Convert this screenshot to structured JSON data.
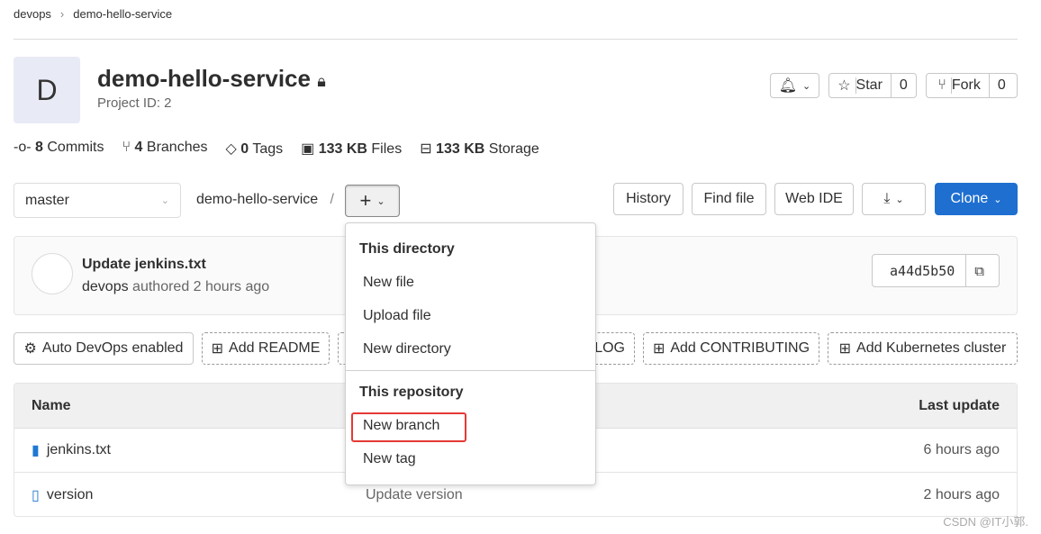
{
  "breadcrumb": [
    "devops",
    "demo-hello-service"
  ],
  "project": {
    "avatar_letter": "D",
    "name": "demo-hello-service",
    "id_label": "Project ID: 2"
  },
  "actions": {
    "star": "Star",
    "star_count": "0",
    "fork": "Fork",
    "fork_count": "0"
  },
  "stats": [
    {
      "icon": "commit-icon",
      "num": "8",
      "label": "Commits"
    },
    {
      "icon": "branch-icon",
      "num": "4",
      "label": "Branches"
    },
    {
      "icon": "tag-icon",
      "num": "0",
      "label": "Tags"
    },
    {
      "icon": "file-icon",
      "num": "133 KB",
      "label": "Files"
    },
    {
      "icon": "storage-icon",
      "num": "133 KB",
      "label": "Storage"
    }
  ],
  "toolbar": {
    "branch": "master",
    "path": "demo-hello-service",
    "sep": "/",
    "history": "History",
    "find_file": "Find file",
    "web_ide": "Web IDE",
    "clone": "Clone"
  },
  "commit": {
    "title": "Update jenkins.txt",
    "author": "devops",
    "meta": "authored 2 hours ago",
    "sha": "a44d5b50"
  },
  "quick_actions": {
    "auto_devops": "Auto DevOps enabled",
    "readme": "Add README",
    "changelog": "Add CHANGELOG",
    "contributing": "Add CONTRIBUTING",
    "k8s": "Add Kubernetes cluster"
  },
  "table": {
    "name_header": "Name",
    "update_header": "Last update",
    "rows": [
      {
        "name": "jenkins.txt",
        "message": "",
        "updated": "6 hours ago"
      },
      {
        "name": "version",
        "message": "Update version",
        "updated": "2 hours ago"
      }
    ]
  },
  "menu": {
    "dir_header": "This directory",
    "new_file": "New file",
    "upload_file": "Upload file",
    "new_directory": "New directory",
    "repo_header": "This repository",
    "new_branch": "New branch",
    "new_tag": "New tag"
  },
  "colors": {
    "primary": "#1f6fd0",
    "highlight": "#e53935"
  },
  "watermark": "CSDN @IT小郭."
}
